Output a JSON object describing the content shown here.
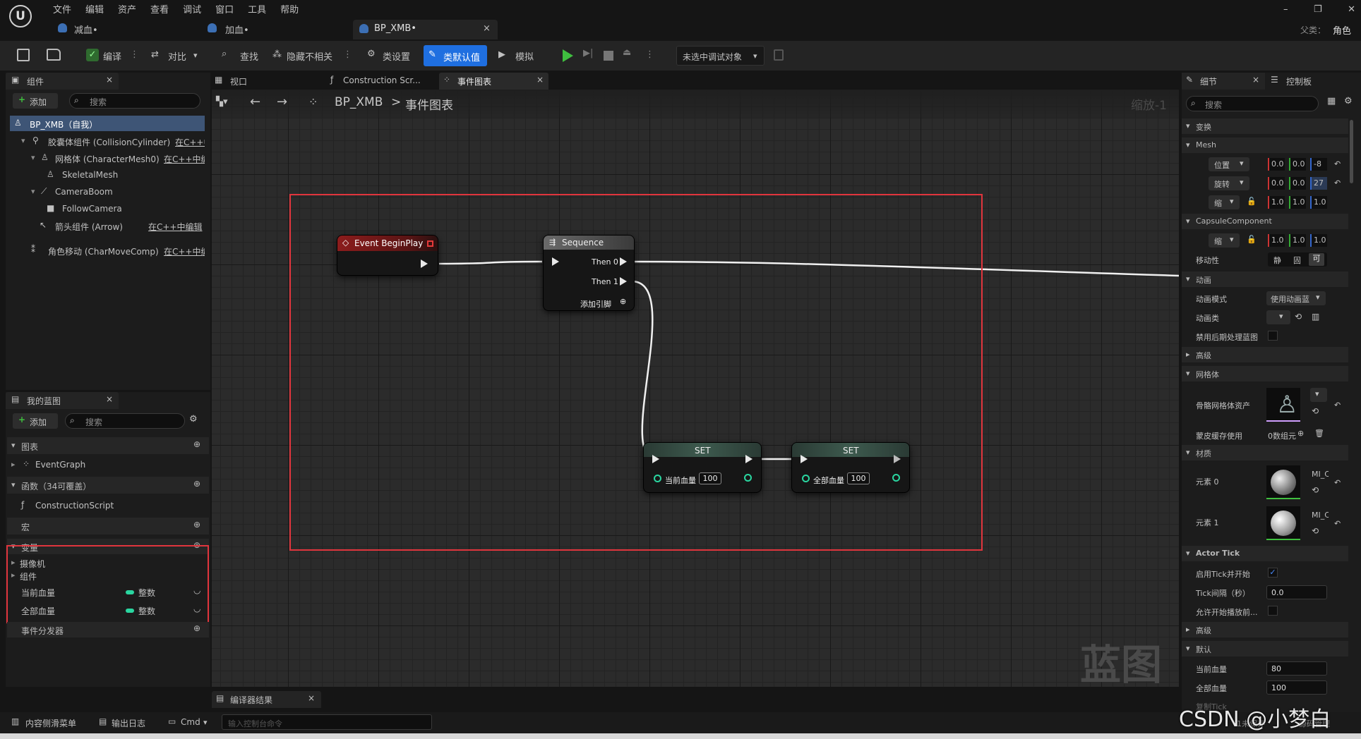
{
  "menu": [
    "文件",
    "编辑",
    "资产",
    "查看",
    "调试",
    "窗口",
    "工具",
    "帮助"
  ],
  "doc_tabs": [
    "减血•",
    "加血•",
    "BP_XMB•"
  ],
  "parent_label": "父类：",
  "parent_value": "角色",
  "toolbar": {
    "compile": "编译",
    "diff": "对比",
    "find": "查找",
    "hide_unrelated": "隐藏不相关",
    "class_settings": "类设置",
    "class_defaults": "类默认值",
    "simulate": "模拟",
    "debug_target": "未选中调试对象"
  },
  "components": {
    "title": "组件",
    "add": "添加",
    "search_placeholder": "搜索",
    "tree": [
      {
        "label": "BP_XMB（自我）",
        "extra": ""
      },
      {
        "label": "胶囊体组件 (CollisionCylinder)",
        "extra": "在C++中"
      },
      {
        "label": "网格体 (CharacterMesh0)",
        "extra": "在C++中编"
      },
      {
        "label": "SkeletalMesh",
        "extra": ""
      },
      {
        "label": "CameraBoom",
        "extra": ""
      },
      {
        "label": "FollowCamera",
        "extra": ""
      },
      {
        "label": "箭头组件 (Arrow)",
        "extra": "在C++中编辑"
      },
      {
        "label": "角色移动 (CharMoveComp)",
        "extra": "在C++中编"
      }
    ]
  },
  "mybp": {
    "title": "我的蓝图",
    "add": "添加",
    "search_placeholder": "搜索",
    "graphs": "图表",
    "eventgraph": "EventGraph",
    "functions": "函数（34可覆盖）",
    "construction": "ConstructionScript",
    "macros": "宏",
    "variables": "变量",
    "var_groups": [
      "摄像机",
      "组件"
    ],
    "vars": [
      {
        "name": "当前血量",
        "type": "整数"
      },
      {
        "name": "全部血量",
        "type": "整数"
      }
    ],
    "dispatchers": "事件分发器"
  },
  "graph": {
    "tabs": [
      "视口",
      "Construction Scr...",
      "事件图表"
    ],
    "breadcrumb_root": "BP_XMB",
    "breadcrumb_sep": ">",
    "breadcrumb_leaf": "事件图表",
    "zoom": "缩放-1",
    "watermark": "蓝图",
    "nodes": {
      "begin": "Event BeginPlay",
      "seq": "Sequence",
      "then0": "Then 0",
      "then1": "Then 1",
      "add_pin": "添加引脚",
      "set": "SET",
      "set1_var": "当前血量",
      "set1_val": "100",
      "set2_var": "全部血量",
      "set2_val": "100"
    }
  },
  "details": {
    "tab_details": "细节",
    "tab_palette": "控制板",
    "search_placeholder": "搜索",
    "transform": "变换",
    "mesh": "Mesh",
    "loc": "位置",
    "rot": "旋转",
    "scale": "缩",
    "loc_vals": [
      "0.0",
      "0.0",
      "-8"
    ],
    "rot_vals": [
      "0.0",
      "0.0",
      "27"
    ],
    "scale_vals": [
      "1.0",
      "1.0",
      "1.0"
    ],
    "capsule": "CapsuleComponent",
    "capsule_scale": "缩",
    "cap_vals": [
      "1.0",
      "1.0",
      "1.0"
    ],
    "mobility": "移动性",
    "mob_opts": [
      "静",
      "固",
      "可"
    ],
    "animation": "动画",
    "anim_mode": "动画模式",
    "anim_mode_val": "使用动画蓝",
    "anim_class": "动画类",
    "disable_post": "禁用后期处理蓝图",
    "advanced": "高级",
    "mesh_sec": "网格体",
    "skel_asset": "骨骼网格体资产",
    "skin_cache": "蒙皮缓存使用",
    "skin_cache_val": "0数组元",
    "materials": "材质",
    "elem0": "元素 0",
    "elem1": "元素 1",
    "mat_name": "MI_C",
    "actor_tick": "Actor Tick",
    "tick_start": "启用Tick并开始",
    "tick_interval": "Tick间隔（秒）",
    "tick_interval_val": "0.0",
    "allow_tick": "允许开始播放前...",
    "advanced2": "高级",
    "defaults": "默认",
    "cur_hp": "当前血量",
    "cur_hp_val": "80",
    "all_hp": "全部血量",
    "all_hp_val": "100",
    "replication": "复制Tick"
  },
  "compiler_tab": "编译器结果",
  "statusbar": {
    "content": "内容侧滑菜单",
    "output": "输出日志",
    "cmd": "Cmd",
    "console_placeholder": "输入控制台命令",
    "saved": "1未保存",
    "source": "源码管理"
  },
  "watermark_csdn": "CSDN @小梦白"
}
